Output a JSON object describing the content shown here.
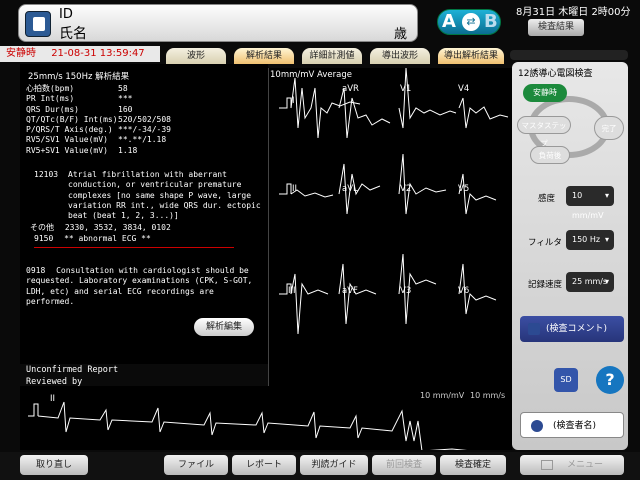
{
  "header": {
    "id_label": "ID",
    "name_label": "氏名",
    "age_label": "歳",
    "mode_a": "A",
    "mode_b": "B",
    "datetime": "8月31日 木曜日 2時00分",
    "exam_result_btn": "検査結果"
  },
  "status": {
    "label": "安静時",
    "timestamp": "21-08-31 13:59:47"
  },
  "tabs": [
    "波形",
    "解析結果",
    "詳細計測値",
    "導出波形",
    "導出解析結果"
  ],
  "report": {
    "heading": "25mm/s 150Hz 解析結果",
    "measurements": [
      {
        "label": "心拍数(bpm)",
        "value": "58"
      },
      {
        "label": "PR Int(ms)",
        "value": "***"
      },
      {
        "label": "QRS Dur(ms)",
        "value": "160"
      },
      {
        "label": "QT/QTc(B/F) Int(ms)",
        "value": "520/502/508"
      },
      {
        "label": "P/QRS/T Axis(deg.)",
        "value": "***/-34/-39"
      },
      {
        "label": "RV5/SV1 Value(mV)",
        "value": "**.**/1.18"
      },
      {
        "label": "RV5+SV1 Value(mV)",
        "value": "1.18"
      }
    ],
    "finding_code": "12103",
    "finding_lines": [
      "Atrial fibrillation with aberrant",
      "conduction, or ventricular premature",
      "complexes [no same shape P wave, large",
      "variation RR int., wide QRS dur. ectopic",
      "beat (beat 1, 2, 3...)]"
    ],
    "other_label": "その他",
    "other_codes": "2330, 3532, 3834, 0102",
    "abnormal_code": "9150",
    "abnormal_text": "** abnormal ECG **",
    "consult_code": "0918",
    "consult_lines": [
      "Consultation with cardiologist should be",
      "requested. Laboratory examinations (CPK, S-GOT,",
      "LDH, etc) and serial ECG recordings are",
      "performed."
    ],
    "edit_btn": "解析編集",
    "unconfirmed": "Unconfirmed Report",
    "reviewed": "Reviewed by"
  },
  "ecg": {
    "scale": "10mm/mV Average",
    "leads": [
      "I",
      "II",
      "III",
      "aVR",
      "aVL",
      "aVF",
      "V1",
      "V2",
      "V3",
      "V4",
      "V5",
      "V6"
    ],
    "rhythm_lead": "II",
    "rhythm_scale": "10 mm/mV",
    "rhythm_speed": "10 mm/s"
  },
  "panel": {
    "title": "12誘導心電図検査",
    "rest": "安静時",
    "master": "マスタステップ",
    "done": "完了",
    "load": "負荷後",
    "sens_label": "感度",
    "sens_value": "10 mm/mV",
    "filter_label": "フィルタ",
    "filter_value": "150 Hz",
    "speed_label": "記録速度",
    "speed_value": "25 mm/s",
    "comment_btn": "(検査コメント)",
    "sd_label": "SD",
    "help": "?",
    "examiner_btn": "(検査者名)"
  },
  "bottom": {
    "retake": "取り直し",
    "file": "ファイル",
    "report": "レポート",
    "guide": "判読ガイド",
    "prev": "前回検査",
    "confirm": "検査確定",
    "menu": "メニュー"
  }
}
